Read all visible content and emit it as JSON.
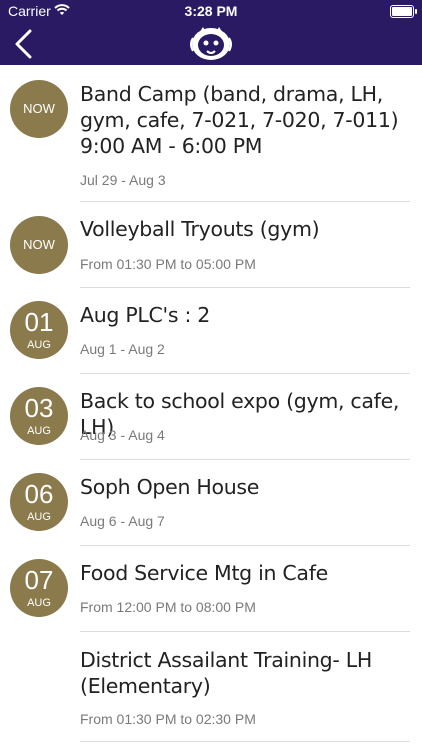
{
  "status_bar": {
    "carrier": "Carrier",
    "time": "3:28 PM"
  },
  "header": {
    "back_icon": "chevron-left-icon",
    "logo_icon": "mascot-logo-icon"
  },
  "events": [
    {
      "badge": "NOW",
      "title": "Band Camp (band, drama, LH, gym, cafe, 7-021, 7-020, 7-011)  9:00 AM - 6:00 PM",
      "subtitle": "Jul 29 - Aug 3"
    },
    {
      "badge": "NOW",
      "title": "Volleyball Tryouts (gym)",
      "subtitle": "From 01:30 PM to 05:00 PM"
    },
    {
      "day": "01",
      "month": "AUG",
      "title": "Aug PLC's : 2",
      "subtitle": "Aug 1 - Aug 2"
    },
    {
      "day": "03",
      "month": "AUG",
      "title": "Back to school expo (gym, cafe, LH)",
      "subtitle": "Aug 3 - Aug 4"
    },
    {
      "day": "06",
      "month": "AUG",
      "title": "Soph Open House",
      "subtitle": "Aug 6 - Aug 7"
    },
    {
      "day": "07",
      "month": "AUG",
      "title": "Food Service  Mtg in Cafe",
      "subtitle": "From 12:00 PM to 08:00 PM"
    },
    {
      "title": "District Assailant Training- LH (Elementary)",
      "subtitle": "From 01:30 PM to 02:30 PM"
    }
  ],
  "colors": {
    "header_bg": "#2a1a64",
    "badge_bg": "#8a7a4c"
  }
}
